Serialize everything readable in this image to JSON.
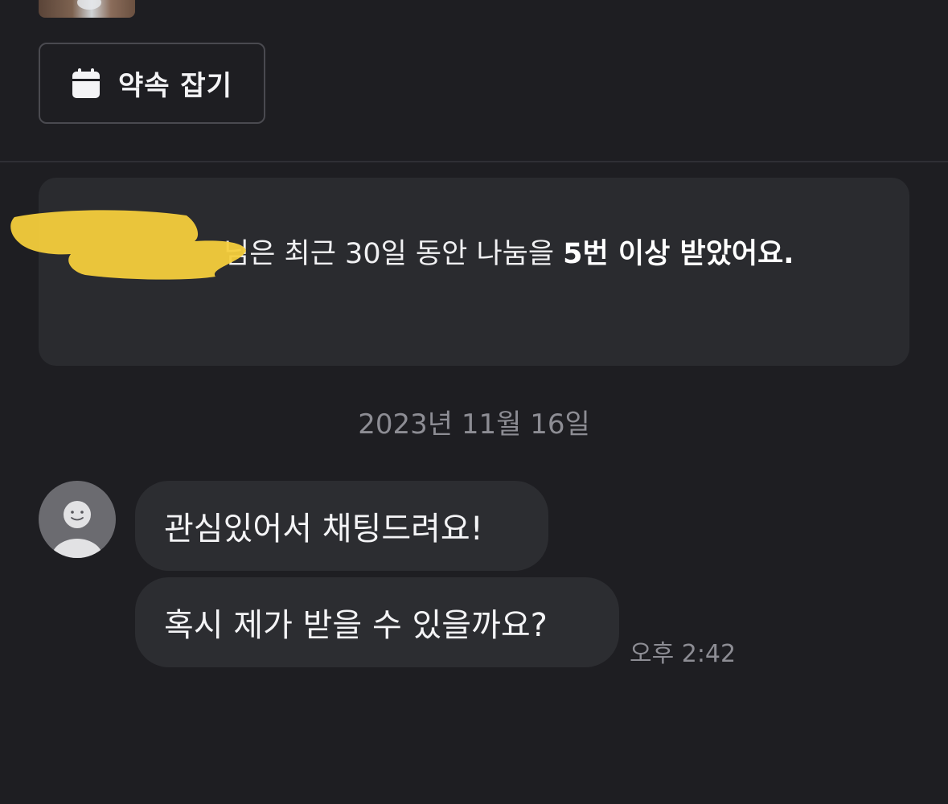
{
  "top_image": {
    "icon": "listing-photo-thumbnail"
  },
  "appointment_button": {
    "label": "약속 잡기",
    "icon": "calendar-icon"
  },
  "notice": {
    "name": "",
    "text_prefix": "님은 최근 30일 동안 나눔을 ",
    "text_bold": "5번 이상 받았어요."
  },
  "date_separator": "2023년 11월 16일",
  "messages": [
    {
      "text": "관심있어서 채팅드려요!"
    },
    {
      "text": "혹시 제가 받을 수 있을까요?"
    }
  ],
  "message_time": "오후 2:42",
  "colors": {
    "background": "#1e1e22",
    "bubble": "#2c2d31",
    "notice_bg": "#2a2b2f",
    "muted_text": "#8d8d94",
    "redaction": "#f4cd3c"
  }
}
